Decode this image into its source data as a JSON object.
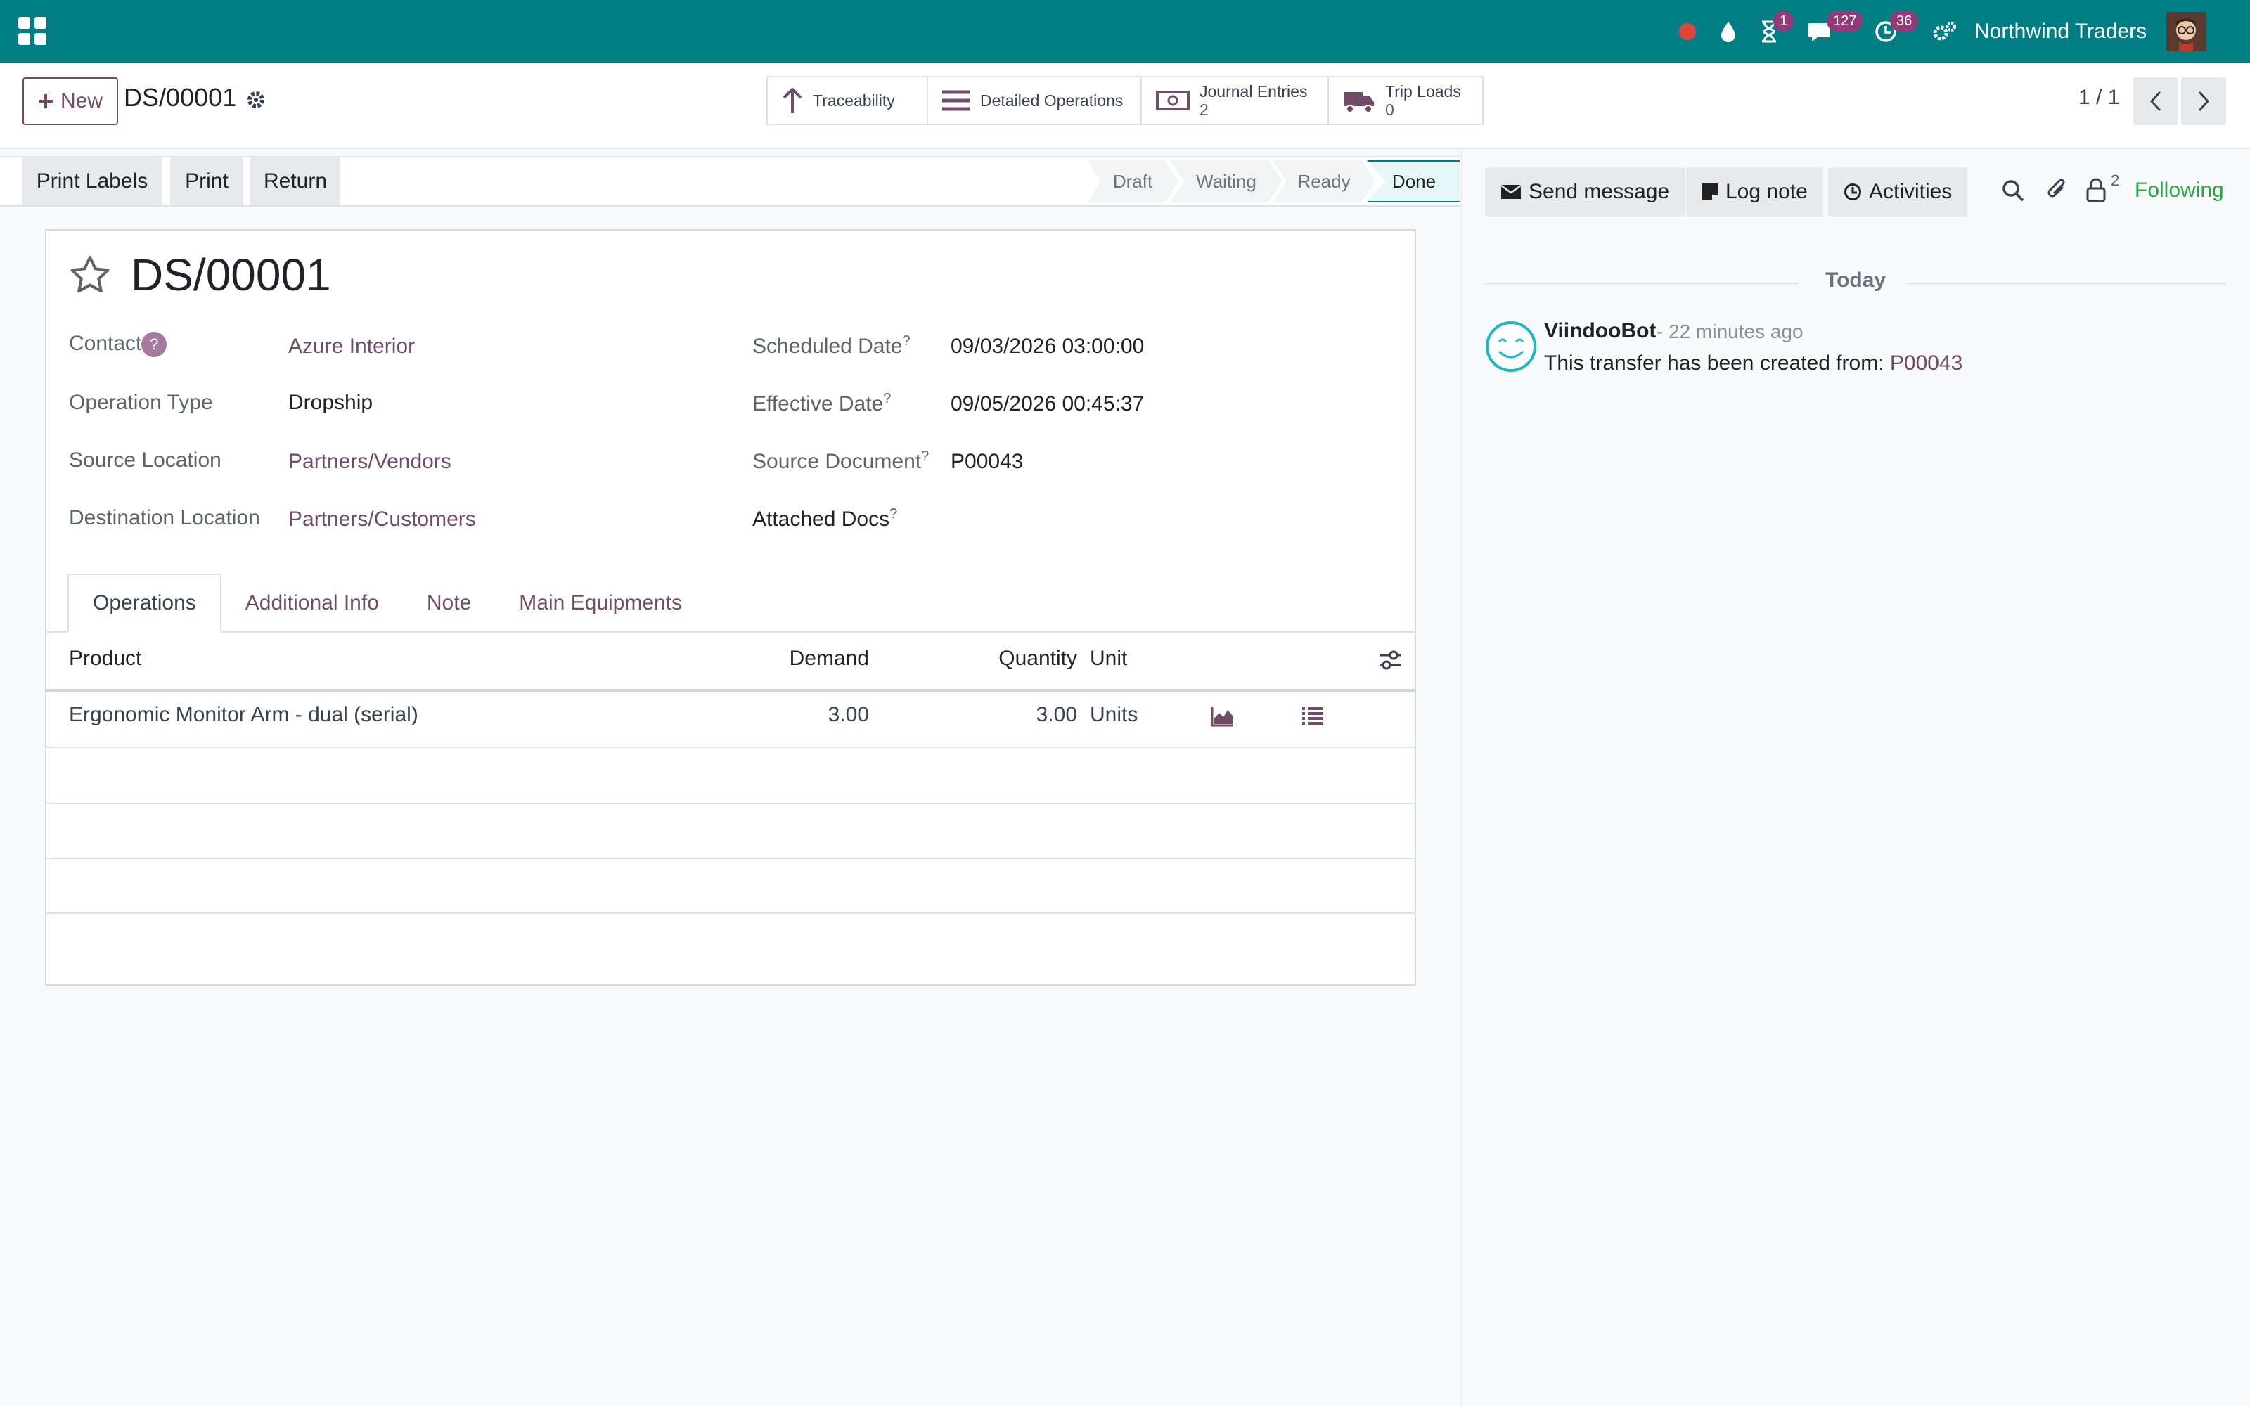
{
  "navbar": {
    "activities_badge": "1",
    "messages_badge": "127",
    "clock_badge": "36",
    "company": "Northwind Traders"
  },
  "control": {
    "new_label": "New",
    "breadcrumb": "DS/00001",
    "smart_buttons": {
      "traceability": "Traceability",
      "detailed_operations": "Detailed Operations",
      "journal_entries": "Journal Entries",
      "journal_entries_count": "2",
      "trip_loads": "Trip Loads",
      "trip_loads_count": "0"
    },
    "pager": "1 / 1"
  },
  "statusbar": {
    "actions": [
      "Print Labels",
      "Print",
      "Return"
    ],
    "stages": [
      "Draft",
      "Waiting",
      "Ready",
      "Done"
    ],
    "current_stage": "Done"
  },
  "form": {
    "title": "DS/00001",
    "help_mark": "?",
    "left_fields": [
      {
        "label": "Contact",
        "value": "Azure Interior"
      },
      {
        "label": "Operation Type",
        "value": "Dropship"
      },
      {
        "label": "Source Location",
        "value": "Partners/Vendors"
      },
      {
        "label": "Destination Location",
        "value": "Partners/Customers"
      }
    ],
    "right_fields": [
      {
        "label": "Scheduled Date",
        "value": "09/03/2026 03:00:00"
      },
      {
        "label": "Effective Date",
        "value": "09/05/2026 00:45:37"
      },
      {
        "label": "Source Document",
        "value": "P00043"
      },
      {
        "label": "Attached Docs",
        "value": ""
      }
    ],
    "tabs": [
      "Operations",
      "Additional Info",
      "Note",
      "Main Equipments"
    ],
    "table": {
      "headers": [
        "Product",
        "Demand",
        "Quantity",
        "Unit"
      ],
      "rows": [
        {
          "product": "Ergonomic Monitor Arm - dual (serial)",
          "demand": "3.00",
          "quantity": "3.00",
          "unit": "Units"
        }
      ]
    }
  },
  "chatter": {
    "send_message": "Send message",
    "log_note": "Log note",
    "activities": "Activities",
    "followers_count": "2",
    "following": "Following",
    "date_separator": "Today",
    "messages": [
      {
        "author": "ViindooBot",
        "time": "- 22 minutes ago",
        "text": "This transfer has been created from:",
        "link": "P00043"
      }
    ]
  }
}
